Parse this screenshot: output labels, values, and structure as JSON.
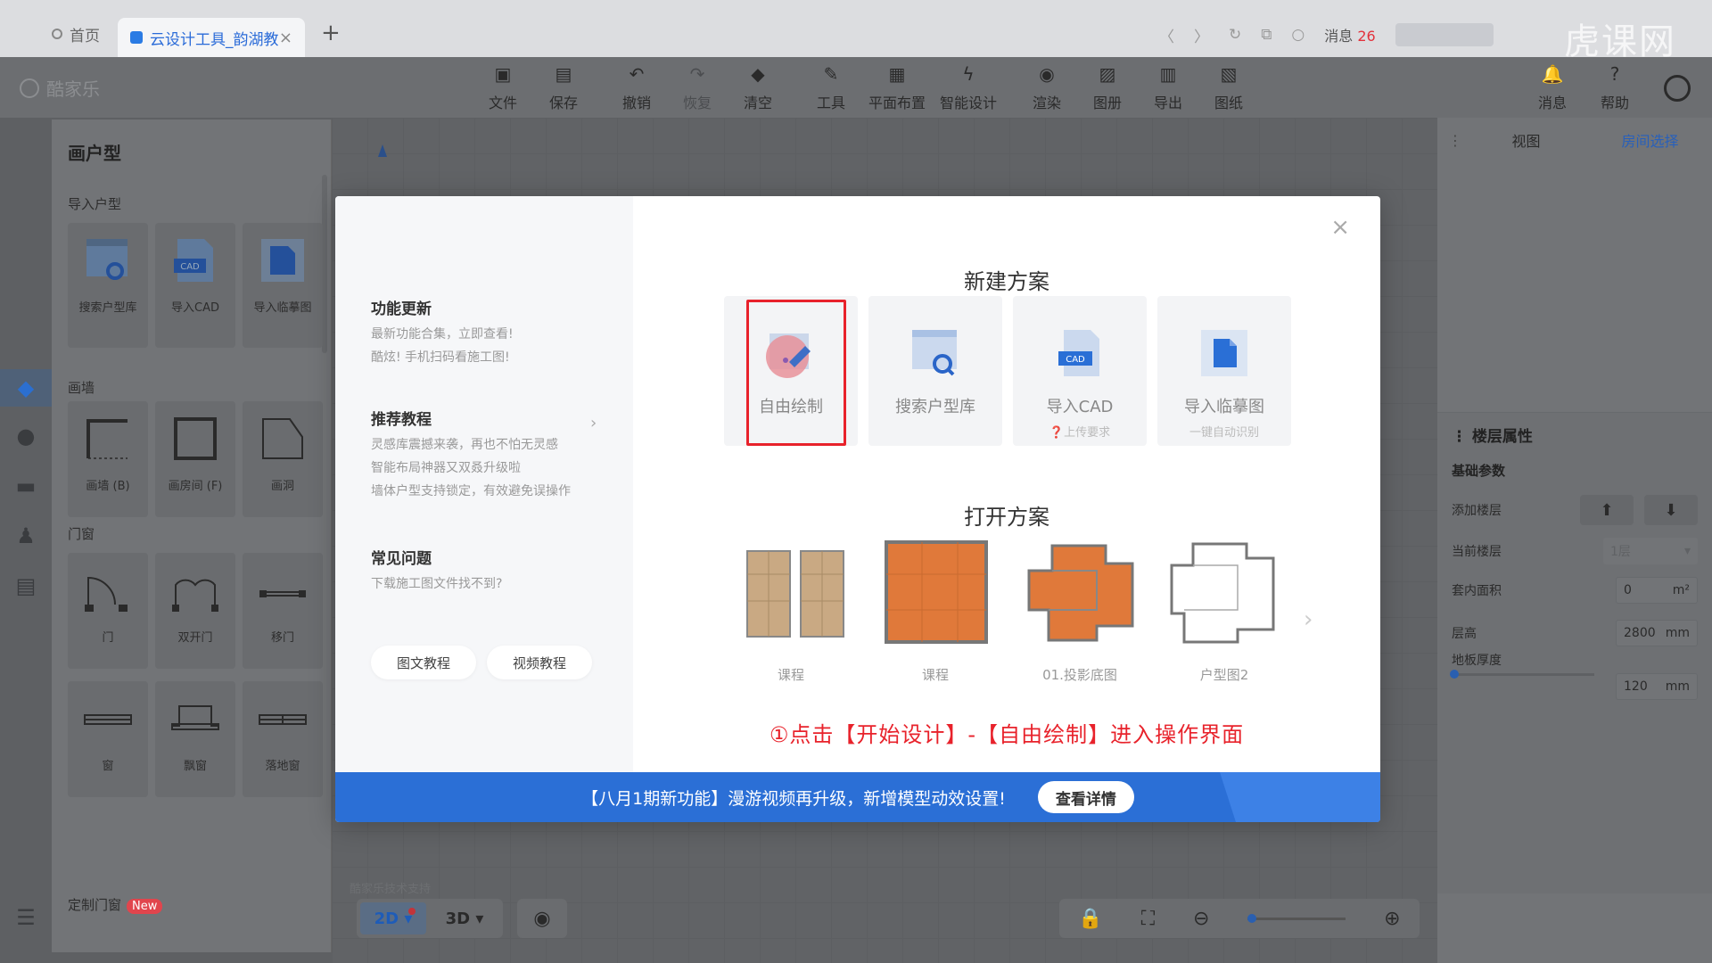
{
  "browser": {
    "home_tab": "首页",
    "active_tab": "云设计工具_韵湖教",
    "tab_close": "×",
    "new_tab": "+",
    "messages_label": "消息",
    "messages_count": "26",
    "watermark": "虎课网"
  },
  "app": {
    "logo": "酷家乐",
    "toolbar": [
      {
        "label": "文件",
        "icon": "file-icon",
        "glyph": "▣"
      },
      {
        "label": "保存",
        "icon": "save-icon",
        "glyph": "▤"
      },
      {
        "label": "撤销",
        "icon": "undo-icon",
        "glyph": "↶"
      },
      {
        "label": "恢复",
        "icon": "redo-icon",
        "glyph": "↷"
      },
      {
        "label": "清空",
        "icon": "eraser-icon",
        "glyph": "◆"
      },
      {
        "label": "工具",
        "icon": "wrench-icon",
        "glyph": "✎"
      },
      {
        "label": "平面布置",
        "icon": "layout-icon",
        "glyph": "▦"
      },
      {
        "label": "智能设计",
        "icon": "lightning-icon",
        "glyph": "ϟ"
      },
      {
        "label": "渲染",
        "icon": "render-icon",
        "glyph": "◉"
      },
      {
        "label": "图册",
        "icon": "album-icon",
        "glyph": "▨"
      },
      {
        "label": "导出",
        "icon": "export-icon",
        "glyph": "▥"
      },
      {
        "label": "图纸",
        "icon": "drawing-icon",
        "glyph": "▧"
      }
    ],
    "right_tools": [
      {
        "label": "消息",
        "icon": "bell-icon",
        "glyph": "🔔"
      },
      {
        "label": "帮助",
        "icon": "help-icon",
        "glyph": "?"
      }
    ]
  },
  "left_panel": {
    "title": "画户型",
    "import_section": "导入户型",
    "import_items": [
      "搜索户型库",
      "导入CAD",
      "导入临摹图"
    ],
    "wall_section": "画墙",
    "wall_items": [
      "画墙 (B)",
      "画房间 (F)",
      "画洞"
    ],
    "door_section": "门窗",
    "door_items": [
      "门",
      "双开门",
      "移门"
    ],
    "window_items": [
      "窗",
      "飘窗",
      "落地窗"
    ],
    "custom_section": "定制门窗",
    "new_badge": "New"
  },
  "canvas": {
    "support_text": "酷家乐技术支持",
    "view_2d": "2D",
    "view_3d": "3D"
  },
  "right_panel": {
    "tab_view": "视图",
    "tab_room": "房间选择",
    "props_title": "楼层属性",
    "basic_params": "基础参数",
    "add_floor": "添加楼层",
    "current_floor": "当前楼层",
    "current_floor_value": "1层",
    "inner_area": "套内面积",
    "inner_area_value": "0",
    "inner_area_unit": "m²",
    "height": "层高",
    "height_value": "2800",
    "height_unit": "mm",
    "floor_thickness": "地板厚度",
    "floor_thickness_value": "120",
    "floor_thickness_unit": "mm"
  },
  "modal": {
    "updates_title": "功能更新",
    "updates_lines": [
      "最新功能合集，立即查看!",
      "酷炫! 手机扫码看施工图!"
    ],
    "tutorials_title": "推荐教程",
    "tutorials_lines": [
      "灵感库震撼来袭，再也不怕无灵感",
      "智能布局神器又双叒升级啦",
      "墙体户型支持锁定，有效避免误操作"
    ],
    "faq_title": "常见问题",
    "faq_lines": [
      "下载施工图文件找不到?"
    ],
    "btn_text_tutorial": "图文教程",
    "btn_video_tutorial": "视频教程",
    "close": "×",
    "new_plan_heading": "新建方案",
    "new_plan_cards": [
      {
        "label": "自由绘制",
        "sub": ""
      },
      {
        "label": "搜索户型库",
        "sub": ""
      },
      {
        "label": "导入CAD",
        "sub": "❓上传要求"
      },
      {
        "label": "导入临摹图",
        "sub": "一键自动识别"
      }
    ],
    "open_plan_heading": "打开方案",
    "open_plan_cards": [
      "课程",
      "课程",
      "01.投影底图",
      "户型图2"
    ],
    "annotation": "①点击【开始设计】-【自由绘制】进入操作界面",
    "banner_text": "【八月1期新功能】漫游视频再升级，新增模型动效设置!",
    "banner_button": "查看详情"
  },
  "colors": {
    "accent": "#2b6fd6",
    "highlight": "#e8222b",
    "wood": "#e0793a"
  }
}
